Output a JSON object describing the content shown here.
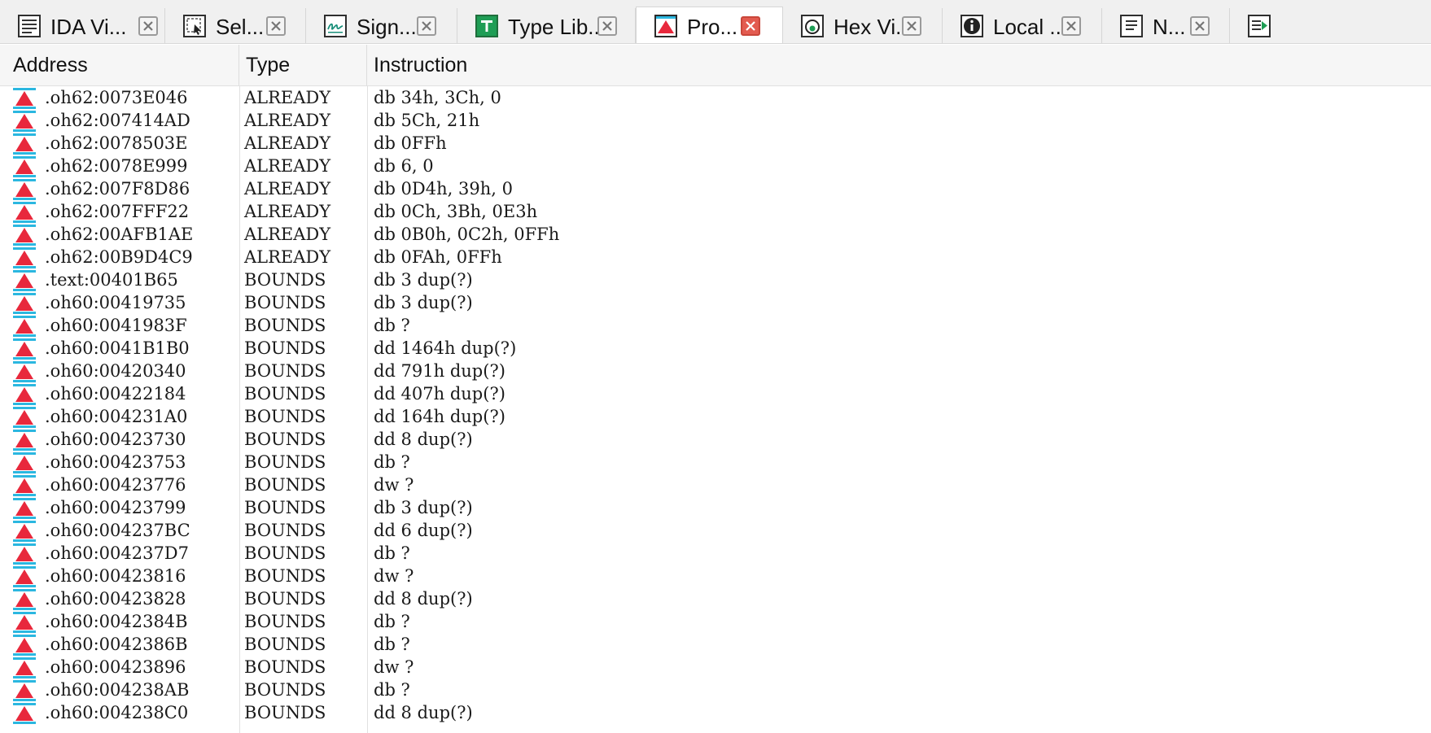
{
  "tabs": [
    {
      "label": "IDA Vi...",
      "icon": "ida-view-icon",
      "active": false
    },
    {
      "label": "Sel...",
      "icon": "selection-icon",
      "active": false
    },
    {
      "label": "Sign...",
      "icon": "signatures-icon",
      "active": false
    },
    {
      "label": "Type Lib...",
      "icon": "type-libraries-icon",
      "active": false
    },
    {
      "label": "Pro...",
      "icon": "problems-icon",
      "active": true
    },
    {
      "label": "Hex Vi...",
      "icon": "hex-view-icon",
      "active": false
    },
    {
      "label": "Local ...",
      "icon": "local-types-icon",
      "active": false
    },
    {
      "label": "N...",
      "icon": "names-icon",
      "active": false
    },
    {
      "label": "",
      "icon": "overflow-tab-icon",
      "active": false
    }
  ],
  "columns": {
    "address": "Address",
    "type": "Type",
    "instruction": "Instruction"
  },
  "rows": [
    {
      "address": ".oh62:0073E046",
      "type": "ALREADY",
      "instruction": "db 34h, 3Ch, 0"
    },
    {
      "address": ".oh62:007414AD",
      "type": "ALREADY",
      "instruction": "db 5Ch, 21h"
    },
    {
      "address": ".oh62:0078503E",
      "type": "ALREADY",
      "instruction": "db 0FFh"
    },
    {
      "address": ".oh62:0078E999",
      "type": "ALREADY",
      "instruction": "db 6, 0"
    },
    {
      "address": ".oh62:007F8D86",
      "type": "ALREADY",
      "instruction": "db 0D4h, 39h, 0"
    },
    {
      "address": ".oh62:007FFF22",
      "type": "ALREADY",
      "instruction": "db 0Ch, 3Bh, 0E3h"
    },
    {
      "address": ".oh62:00AFB1AE",
      "type": "ALREADY",
      "instruction": "db 0B0h, 0C2h, 0FFh"
    },
    {
      "address": ".oh62:00B9D4C9",
      "type": "ALREADY",
      "instruction": "db 0FAh, 0FFh"
    },
    {
      "address": ".text:00401B65",
      "type": "BOUNDS",
      "instruction": "db 3 dup(?)"
    },
    {
      "address": ".oh60:00419735",
      "type": "BOUNDS",
      "instruction": "db 3 dup(?)"
    },
    {
      "address": ".oh60:0041983F",
      "type": "BOUNDS",
      "instruction": "db ?"
    },
    {
      "address": ".oh60:0041B1B0",
      "type": "BOUNDS",
      "instruction": "dd 1464h dup(?)"
    },
    {
      "address": ".oh60:00420340",
      "type": "BOUNDS",
      "instruction": "dd 791h dup(?)"
    },
    {
      "address": ".oh60:00422184",
      "type": "BOUNDS",
      "instruction": "dd 407h dup(?)"
    },
    {
      "address": ".oh60:004231A0",
      "type": "BOUNDS",
      "instruction": "dd 164h dup(?)"
    },
    {
      "address": ".oh60:00423730",
      "type": "BOUNDS",
      "instruction": "dd 8 dup(?)"
    },
    {
      "address": ".oh60:00423753",
      "type": "BOUNDS",
      "instruction": "db ?"
    },
    {
      "address": ".oh60:00423776",
      "type": "BOUNDS",
      "instruction": "dw ?"
    },
    {
      "address": ".oh60:00423799",
      "type": "BOUNDS",
      "instruction": "db 3 dup(?)"
    },
    {
      "address": ".oh60:004237BC",
      "type": "BOUNDS",
      "instruction": "dd 6 dup(?)"
    },
    {
      "address": ".oh60:004237D7",
      "type": "BOUNDS",
      "instruction": "db ?"
    },
    {
      "address": ".oh60:00423816",
      "type": "BOUNDS",
      "instruction": "dw ?"
    },
    {
      "address": ".oh60:00423828",
      "type": "BOUNDS",
      "instruction": "dd 8 dup(?)"
    },
    {
      "address": ".oh60:0042384B",
      "type": "BOUNDS",
      "instruction": "db ?"
    },
    {
      "address": ".oh60:0042386B",
      "type": "BOUNDS",
      "instruction": "db ?"
    },
    {
      "address": ".oh60:00423896",
      "type": "BOUNDS",
      "instruction": "dw ?"
    },
    {
      "address": ".oh60:004238AB",
      "type": "BOUNDS",
      "instruction": "db ?"
    },
    {
      "address": ".oh60:004238C0",
      "type": "BOUNDS",
      "instruction": "dd 8 dup(?)"
    }
  ],
  "row_icon": "problem-warning-icon",
  "colors": {
    "problem_icon_red": "#e8283c",
    "problem_icon_cyan": "#2bb7e0",
    "close_active_red": "#e35b50",
    "tabbar_bg": "#f0f0f0",
    "header_bg": "#f6f6f6"
  }
}
